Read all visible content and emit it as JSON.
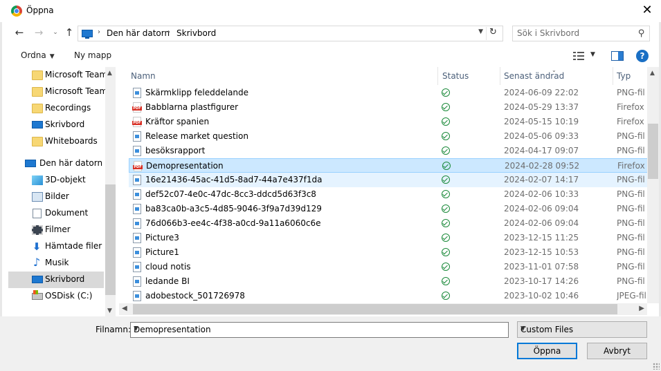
{
  "window": {
    "title": "Öppna"
  },
  "address": {
    "crumbs": [
      "Den här datorn",
      "Skrivbord"
    ],
    "search_placeholder": "Sök i Skrivbord"
  },
  "toolbar": {
    "organize": "Ordna",
    "new_folder": "Ny mapp"
  },
  "nav": {
    "items": [
      {
        "label": "Microsoft Teams",
        "icon": "folder-icon"
      },
      {
        "label": "Microsoft Teams",
        "icon": "folder-icon"
      },
      {
        "label": "Recordings",
        "icon": "folder-icon"
      },
      {
        "label": "Skrivbord",
        "icon": "desktop-icon"
      },
      {
        "label": "Whiteboards",
        "icon": "folder-icon"
      },
      {
        "label": "Den här datorn",
        "icon": "computer-icon"
      },
      {
        "label": "3D-objekt",
        "icon": "3d-objects-icon"
      },
      {
        "label": "Bilder",
        "icon": "pictures-icon"
      },
      {
        "label": "Dokument",
        "icon": "documents-icon"
      },
      {
        "label": "Filmer",
        "icon": "videos-icon"
      },
      {
        "label": "Hämtade filer",
        "icon": "downloads-icon"
      },
      {
        "label": "Musik",
        "icon": "music-icon"
      },
      {
        "label": "Skrivbord",
        "icon": "desktop-icon"
      },
      {
        "label": "OSDisk (C:)",
        "icon": "disk-icon"
      }
    ]
  },
  "columns": {
    "name": "Namn",
    "status": "Status",
    "modified": "Senast ändrad",
    "type": "Typ"
  },
  "files": [
    {
      "name": "Skärmklipp feleddelande",
      "date": "2024-06-09 22:02",
      "type": "PNG-fil",
      "kind": "png"
    },
    {
      "name": "Babblarna plastfigurer",
      "date": "2024-05-29 13:37",
      "type": "Firefox P",
      "kind": "pdf"
    },
    {
      "name": "Kräftor spanien",
      "date": "2024-05-15 10:19",
      "type": "Firefox P",
      "kind": "pdf"
    },
    {
      "name": "Release market question",
      "date": "2024-05-06 09:33",
      "type": "PNG-fil",
      "kind": "png"
    },
    {
      "name": "besöksrapport",
      "date": "2024-04-17 09:07",
      "type": "PNG-fil",
      "kind": "png"
    },
    {
      "name": "Demopresentation",
      "date": "2024-02-28 09:52",
      "type": "Firefox P",
      "kind": "pdf"
    },
    {
      "name": "16e21436-45ac-41d5-8ad7-44a7e437f1da",
      "date": "2024-02-07 14:17",
      "type": "PNG-fil",
      "kind": "png"
    },
    {
      "name": "def52c07-4e0c-47dc-8cc3-ddcd5d63f3c8",
      "date": "2024-02-06 10:33",
      "type": "PNG-fil",
      "kind": "png"
    },
    {
      "name": "ba83ca0b-a3c5-4d85-9046-3f9a7d39d129",
      "date": "2024-02-06 09:04",
      "type": "PNG-fil",
      "kind": "png"
    },
    {
      "name": "76d066b3-ee4c-4f38-a0cd-9a11a6060c6e",
      "date": "2024-02-06 09:04",
      "type": "PNG-fil",
      "kind": "png"
    },
    {
      "name": "Picture3",
      "date": "2023-12-15 11:25",
      "type": "PNG-fil",
      "kind": "png"
    },
    {
      "name": "Picture1",
      "date": "2023-12-15 10:53",
      "type": "PNG-fil",
      "kind": "png"
    },
    {
      "name": "cloud notis",
      "date": "2023-11-01 07:58",
      "type": "PNG-fil",
      "kind": "png"
    },
    {
      "name": "ledande BI",
      "date": "2023-10-17 14:26",
      "type": "PNG-fil",
      "kind": "png"
    },
    {
      "name": "adobestock_501726978",
      "date": "2023-10-02 10:46",
      "type": "JPEG-fil",
      "kind": "png"
    }
  ],
  "footer": {
    "filename_label": "Filnamn:",
    "filename_value": "Demopresentation",
    "filter_value": "Custom Files",
    "open_label": "Öppna",
    "cancel_label": "Avbryt"
  },
  "colors": {
    "selection": "#cce8ff",
    "hover": "#e5f3ff",
    "accent": "#0078d7",
    "status_ok": "#1b8a3a"
  }
}
